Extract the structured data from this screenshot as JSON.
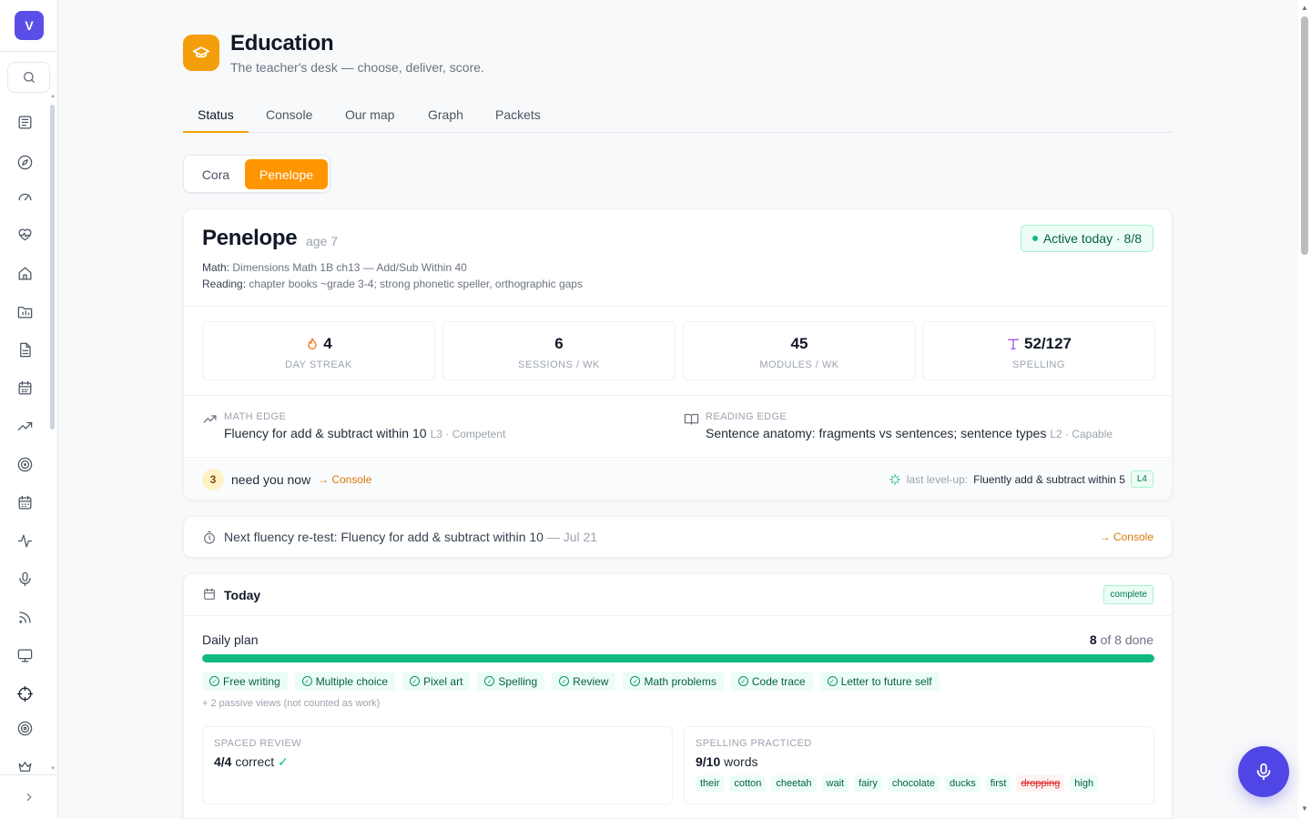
{
  "sidebar": {
    "avatar_letter": "V",
    "icons": [
      "newspaper-icon",
      "compass-icon",
      "gauge-icon",
      "heart-pulse-icon",
      "home-icon",
      "folder-chart-icon",
      "file-text-icon",
      "calendar-grid-icon",
      "trending-up-icon",
      "target-icon",
      "calendar-icon",
      "activity-icon",
      "mic-icon",
      "rss-icon",
      "monitor-icon",
      "crosshair-icon",
      "radar-icon",
      "crown-icon"
    ]
  },
  "header": {
    "title": "Education",
    "subtitle": "The teacher's desk — choose, deliver, score."
  },
  "tabs": [
    {
      "label": "Status",
      "active": true
    },
    {
      "label": "Console",
      "active": false
    },
    {
      "label": "Our map",
      "active": false
    },
    {
      "label": "Graph",
      "active": false
    },
    {
      "label": "Packets",
      "active": false
    }
  ],
  "children": {
    "options": [
      "Cora",
      "Penelope"
    ],
    "selected": "Penelope"
  },
  "profile": {
    "name": "Penelope",
    "age": "age 7",
    "math_key": "Math:",
    "math_val": "Dimensions Math 1B ch13 — Add/Sub Within 40",
    "reading_key": "Reading:",
    "reading_val": "chapter books ~grade 3-4; strong phonetic speller, orthographic gaps",
    "active_badge": "Active today · 8/8"
  },
  "stats": [
    {
      "value": "4",
      "label": "DAY STREAK",
      "icon": "flame-icon"
    },
    {
      "value": "6",
      "label": "SESSIONS / WK",
      "icon": ""
    },
    {
      "value": "45",
      "label": "MODULES / WK",
      "icon": ""
    },
    {
      "value": "52/127",
      "label": "SPELLING",
      "icon": "type-icon"
    }
  ],
  "edges": {
    "math": {
      "label": "MATH EDGE",
      "value": "Fluency for add & subtract within 10",
      "level": "L3 · Competent"
    },
    "reading": {
      "label": "READING EDGE",
      "value": "Sentence anatomy: fragments vs sentences; sentence types",
      "level": "L2 · Capable"
    }
  },
  "needs": {
    "count": "3",
    "text": "need you now",
    "link": "→ Console",
    "levelup_key": "last level-up:",
    "levelup_val": "Fluently add & subtract within 5",
    "levelup_level": "L4"
  },
  "retest": {
    "text": "Next fluency re-test: Fluency for add & subtract within 10",
    "date": "— Jul 21",
    "link": "→ Console"
  },
  "today": {
    "title": "Today",
    "badge": "complete",
    "plan_label": "Daily plan",
    "done": "8",
    "total_text": "of 8 done",
    "progress": 1.0,
    "items": [
      "Free writing",
      "Multiple choice",
      "Pixel art",
      "Spelling",
      "Review",
      "Math problems",
      "Code trace",
      "Letter to future self"
    ],
    "passive_note": "+ 2 passive views (not counted as work)",
    "spaced": {
      "label": "SPACED REVIEW",
      "score": "4/4",
      "text": "correct",
      "tick": "✓"
    },
    "spelling": {
      "label": "SPELLING PRACTICED",
      "score": "9/10",
      "text": "words",
      "words": [
        {
          "w": "their",
          "ok": true
        },
        {
          "w": "cotton",
          "ok": true
        },
        {
          "w": "cheetah",
          "ok": true
        },
        {
          "w": "wait",
          "ok": true
        },
        {
          "w": "fairy",
          "ok": true
        },
        {
          "w": "chocolate",
          "ok": true
        },
        {
          "w": "ducks",
          "ok": true
        },
        {
          "w": "first",
          "ok": true
        },
        {
          "w": "dropping",
          "ok": false
        },
        {
          "w": "high",
          "ok": true
        }
      ]
    }
  },
  "colors": {
    "accent": "#ff9500",
    "brand": "#5b4ee8",
    "success": "#10b981"
  }
}
